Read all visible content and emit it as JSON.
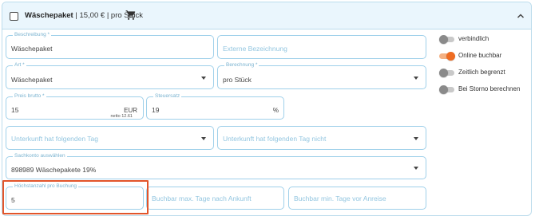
{
  "header": {
    "title": "Wäschepaket",
    "details": " | 15,00 € | pro Stück",
    "cart_icon": "cart-icon",
    "collapse_icon": "chevron-up-icon"
  },
  "fields": {
    "beschreibung": {
      "label": "Beschreibung *",
      "value": "Wäschepaket"
    },
    "externe_bezeichnung": {
      "placeholder": "Externe Bezeichnung"
    },
    "art": {
      "label": "Art *",
      "value": "Wäschepaket"
    },
    "berechnung": {
      "label": "Berechnung *",
      "value": "pro Stück"
    },
    "preis_brutto": {
      "label": "Preis brutto *",
      "value": "15",
      "suffix": "EUR",
      "hint": "netto 12.61"
    },
    "steuersatz": {
      "label": "Steuersatz",
      "value": "19",
      "suffix": "%"
    },
    "tag": {
      "placeholder": "Unterkunft hat folgenden Tag"
    },
    "tag_nicht": {
      "placeholder": "Unterkunft hat folgenden Tag nicht"
    },
    "sachkonto": {
      "label": "Sachkonto auswählen",
      "value": "898989 Wäschepakete 19%"
    },
    "hoechstanzahl": {
      "label": "Höchstanzahl pro Buchung",
      "value": "5"
    },
    "max_tage": {
      "placeholder": "Buchbar max. Tage nach Ankunft"
    },
    "min_tage": {
      "placeholder": "Buchbar min. Tage vor Anreise"
    }
  },
  "toggles": [
    {
      "label": "verbindlich",
      "on": false
    },
    {
      "label": "Online buchbar",
      "on": true
    },
    {
      "label": "Zeitlich begrenzt",
      "on": false
    },
    {
      "label": "Bei Storno berechnen",
      "on": false
    }
  ],
  "colors": {
    "accent_border": "#9fd0ea",
    "toggle_on": "#ee6c22",
    "highlight": "#e2552b"
  }
}
